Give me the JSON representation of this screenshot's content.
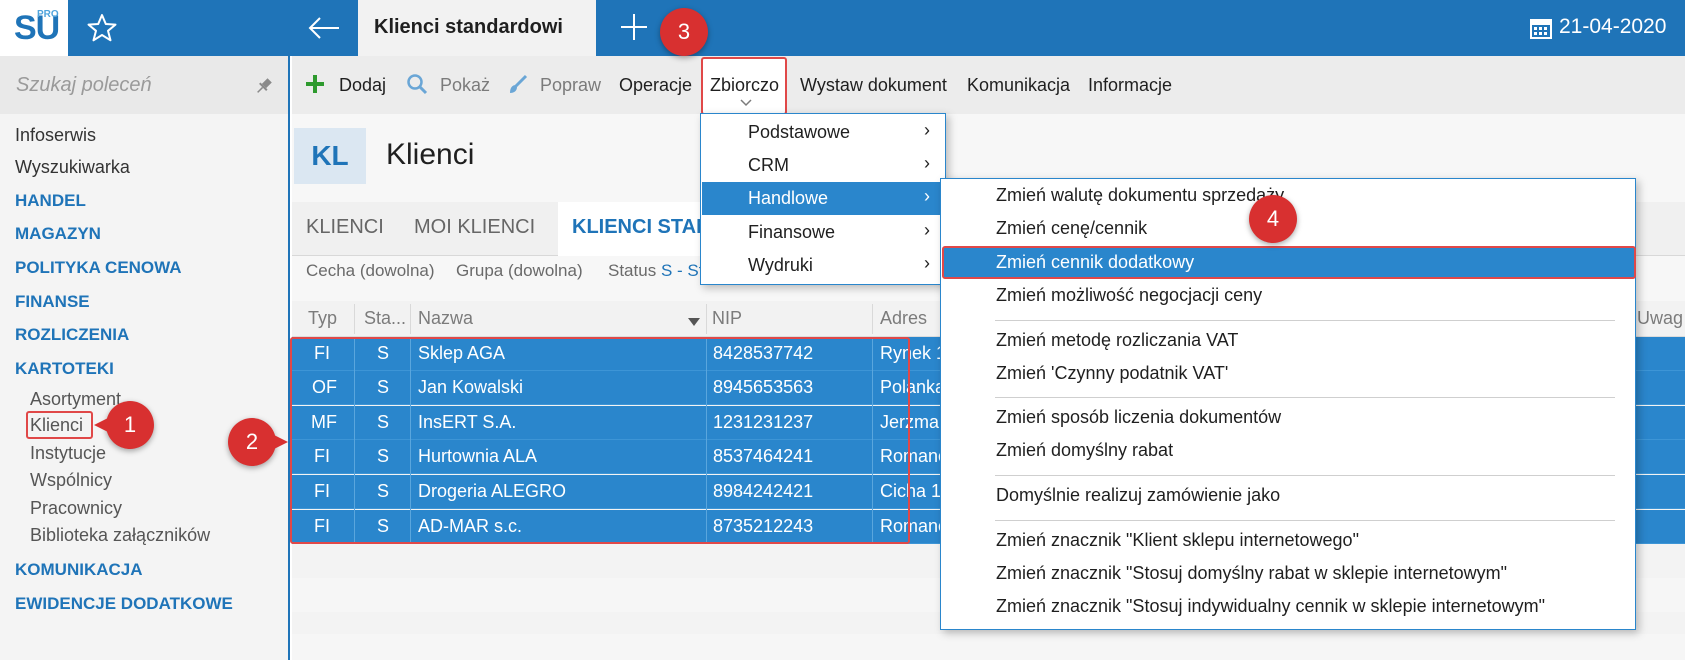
{
  "topbar": {
    "logo_text": "SU",
    "logo_super": "PRO",
    "active_tab": "Klienci standardowi",
    "date": "21-04-2020",
    "colors": {
      "bar": "#1f74b8",
      "accent": "#2a86cc",
      "annotation": "#d83030"
    }
  },
  "sidebar": {
    "search_placeholder": "Szukaj poleceń",
    "items": [
      {
        "label": "Infoserwis"
      },
      {
        "label": "Wyszukiwarka"
      }
    ],
    "sections": [
      {
        "label": "HANDEL"
      },
      {
        "label": "MAGAZYN"
      },
      {
        "label": "POLITYKA CENOWA"
      },
      {
        "label": "FINANSE"
      },
      {
        "label": "ROZLICZENIA"
      },
      {
        "label": "KARTOTEKI"
      },
      {
        "label": "KOMUNIKACJA"
      },
      {
        "label": "EWIDENCJE DODATKOWE"
      }
    ],
    "kartoteki_items": [
      {
        "label": "Asortyment"
      },
      {
        "label": "Klienci"
      },
      {
        "label": "Instytucje"
      },
      {
        "label": "Wspólnicy"
      },
      {
        "label": "Pracownicy"
      },
      {
        "label": "Biblioteka załączników"
      }
    ]
  },
  "toolbar": {
    "add": "Dodaj",
    "show": "Pokaż",
    "edit": "Popraw",
    "operations": "Operacje",
    "bulk": "Zbiorczo",
    "issue_document": "Wystaw dokument",
    "communication": "Komunikacja",
    "information": "Informacje"
  },
  "page": {
    "badge": "KL",
    "title": "Klienci",
    "tabs": [
      {
        "label": "KLIENCI"
      },
      {
        "label": "MOI KLIENCI"
      },
      {
        "label": "KLIENCI STAN"
      }
    ],
    "filters": {
      "feature": "Cecha (dowolna)",
      "group": "Grupa (dowolna)",
      "status_label": "Status",
      "status_value": "S - St"
    }
  },
  "table": {
    "columns": [
      "Typ",
      "Sta...",
      "Nazwa",
      "NIP",
      "Adres",
      "Uwag"
    ],
    "rows": [
      {
        "typ": "FI",
        "status": "S",
        "nazwa": "Sklep AGA",
        "nip": "8428537742",
        "adres": "Rynek 1"
      },
      {
        "typ": "OF",
        "status": "S",
        "nazwa": "Jan Kowalski",
        "nip": "8945653563",
        "adres": "Polanka"
      },
      {
        "typ": "MF",
        "status": "S",
        "nazwa": "InsERT S.A.",
        "nip": "1231231237",
        "adres": "Jerzmar"
      },
      {
        "typ": "FI",
        "status": "S",
        "nazwa": "Hurtownia ALA",
        "nip": "8537464241",
        "adres": "Romanc"
      },
      {
        "typ": "FI",
        "status": "S",
        "nazwa": "Drogeria ALEGRO",
        "nip": "8984242421",
        "adres": "Cicha  1"
      },
      {
        "typ": "FI",
        "status": "S",
        "nazwa": "AD-MAR s.c.",
        "nip": "8735212243",
        "adres": "Romanc"
      }
    ]
  },
  "menu_zbiorczo": {
    "items": [
      {
        "label": "Podstawowe",
        "arrow": "›"
      },
      {
        "label": "CRM",
        "arrow": "›"
      },
      {
        "label": "Handlowe",
        "arrow": "›"
      },
      {
        "label": "Finansowe",
        "arrow": "›"
      },
      {
        "label": "Wydruki",
        "arrow": "›"
      }
    ]
  },
  "menu_handlowe": {
    "items": [
      {
        "label": "Zmień walutę dokumentu sprzedaży"
      },
      {
        "label": "Zmień cenę/cennik"
      },
      {
        "label": "Zmień cennik dodatkowy"
      },
      {
        "label": "Zmień możliwość negocjacji ceny"
      },
      {
        "label": "Zmień metodę rozliczania VAT"
      },
      {
        "label": "Zmień 'Czynny podatnik VAT'"
      },
      {
        "label": "Zmień sposób liczenia dokumentów"
      },
      {
        "label": "Zmień domyślny rabat"
      },
      {
        "label": "Domyślnie realizuj zamówienie jako"
      },
      {
        "label": "Zmień znacznik \"Klient sklepu internetowego\""
      },
      {
        "label": "Zmień znacznik \"Stosuj domyślny rabat w sklepie internetowym\""
      },
      {
        "label": "Zmień znacznik \"Stosuj indywidualny cennik w sklepie internetowym\""
      }
    ]
  },
  "annotations": [
    "1",
    "2",
    "3",
    "4"
  ]
}
